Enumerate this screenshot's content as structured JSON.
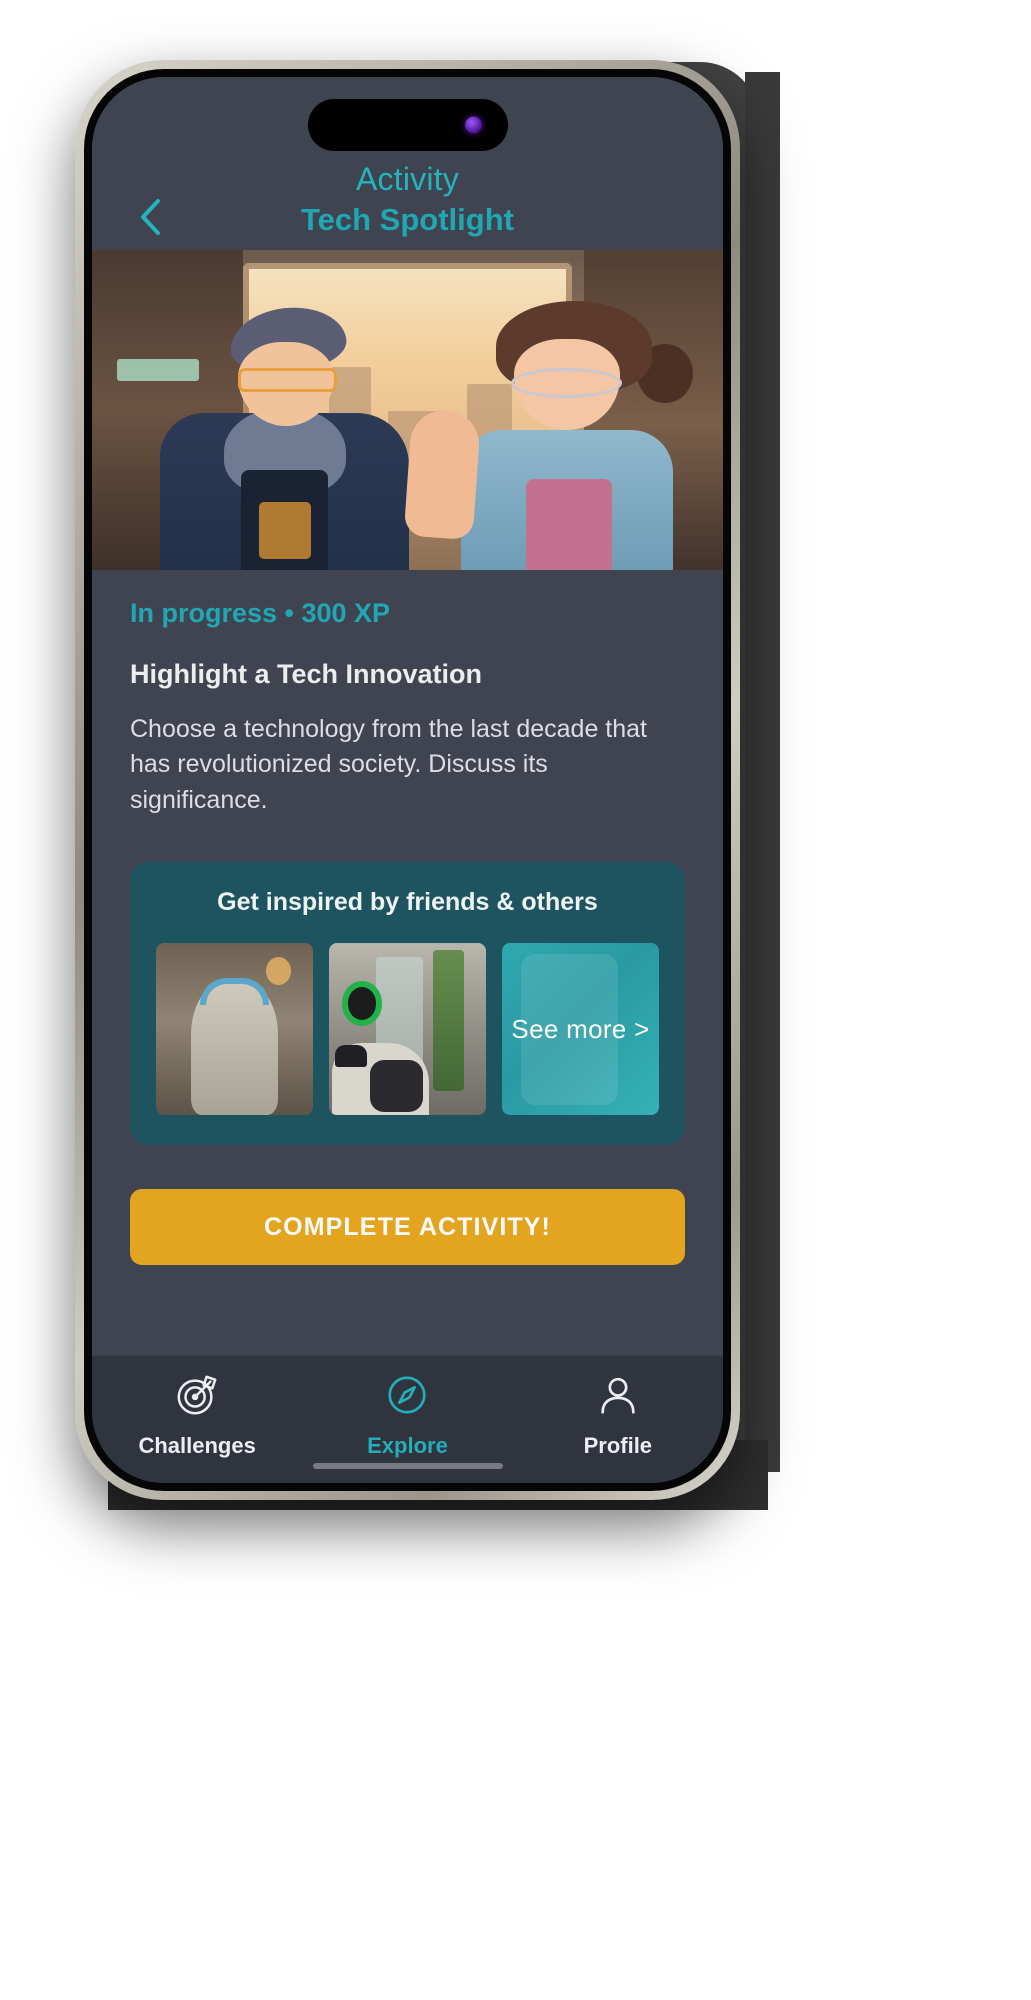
{
  "header": {
    "back_icon": "chevron-left-icon",
    "title": "Activity",
    "subtitle": "Tech Spotlight",
    "title_color": "#23b5bd"
  },
  "hero": {
    "alt": "illustration-two-people-talking"
  },
  "activity": {
    "status_line": "In progress • 300 XP",
    "status_text": "In progress",
    "xp": "300 XP",
    "status_color": "#1fa8b4",
    "title": "Highlight a Tech Innovation",
    "description": "Choose a technology from the last decade that has revolutionized society. Discuss its significance."
  },
  "inspire": {
    "title": "Get inspired by friends & others",
    "card_color": "#1e5460",
    "thumbnails": [
      {
        "name": "thumbnail-statue-headphones"
      },
      {
        "name": "thumbnail-person-wall-device"
      }
    ],
    "see_more_label": "See more >",
    "see_more_color": "#2fa8ae"
  },
  "cta": {
    "label": "COMPLETE ACTIVITY!",
    "color": "#e3a41f"
  },
  "tabbar": {
    "items": [
      {
        "label": "Challenges",
        "icon": "target-dart-icon",
        "active": false
      },
      {
        "label": "Explore",
        "icon": "compass-icon",
        "active": true
      },
      {
        "label": "Profile",
        "icon": "user-person-icon",
        "active": false
      }
    ],
    "active_color": "#23aeb8",
    "inactive_color": "#eceef1"
  }
}
